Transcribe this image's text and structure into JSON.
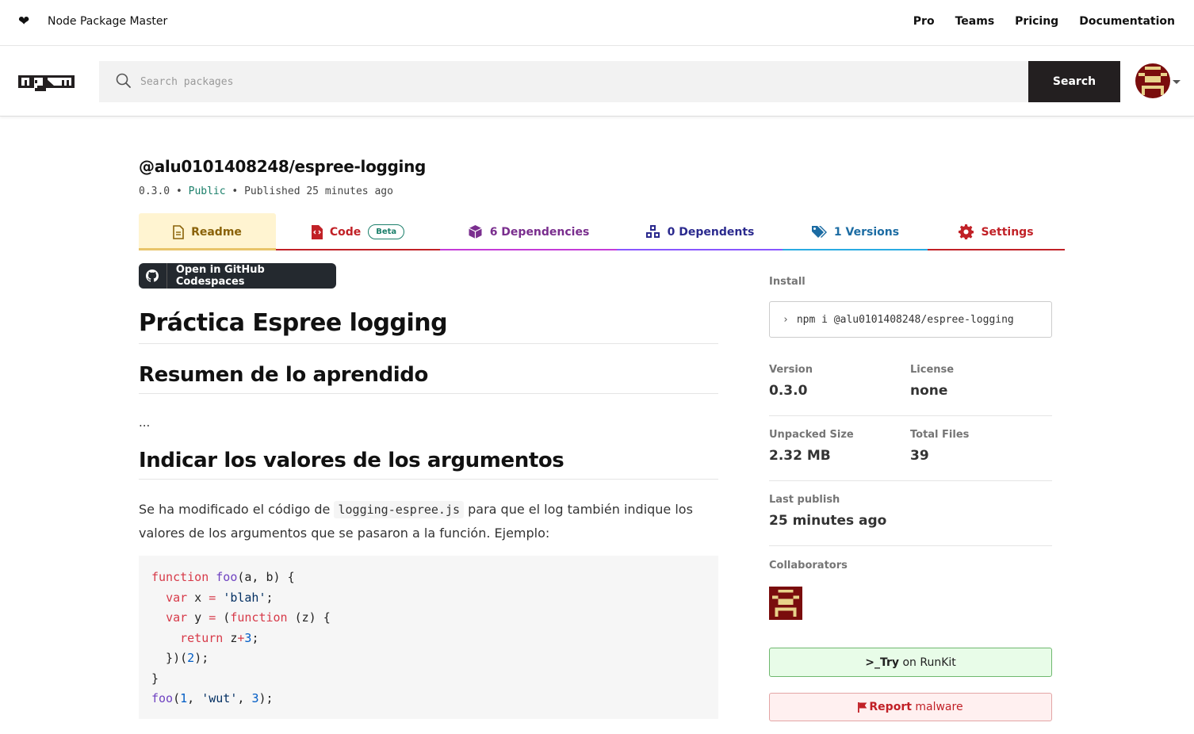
{
  "topbar": {
    "brand": "Node Package Master",
    "nav": [
      "Pro",
      "Teams",
      "Pricing",
      "Documentation"
    ]
  },
  "search": {
    "placeholder": "Search packages",
    "value": "",
    "button_label": "Search"
  },
  "package": {
    "name": "@alu0101408248/espree-logging",
    "version": "0.3.0",
    "visibility": "Public",
    "published": "Published 25 minutes ago",
    "separator": "•"
  },
  "tabs": {
    "readme": "Readme",
    "code": "Code",
    "code_badge": "Beta",
    "dependencies": "6 Dependencies",
    "dependents": "0 Dependents",
    "versions": "1 Versions",
    "settings": "Settings"
  },
  "codespaces_label": "Open in GitHub Codespaces",
  "readme": {
    "h1": "Práctica Espree logging",
    "h2_summary": "Resumen de lo aprendido",
    "ellipsis": "...",
    "h2_args": "Indicar los valores de los argumentos",
    "para_before": "Se ha modificado el código de ",
    "para_code": "logging-espree.js",
    "para_after": " para que el log también indique los valores de los argumentos que se pasaron a la función. Ejemplo:"
  },
  "sidebar": {
    "install_label": "Install",
    "install_prompt": "›",
    "install_command": "npm i @alu0101408248/espree-logging",
    "version_label": "Version",
    "version_value": "0.3.0",
    "license_label": "License",
    "license_value": "none",
    "unpacked_label": "Unpacked Size",
    "unpacked_value": "2.32 MB",
    "files_label": "Total Files",
    "files_value": "39",
    "last_publish_label": "Last publish",
    "last_publish_value": "25 minutes ago",
    "collaborators_label": "Collaborators",
    "runkit_prefix": ">_",
    "runkit_bold": "Try",
    "runkit_rest": " on RunKit",
    "report_bold": "Report",
    "report_rest": " malware"
  },
  "colors": {
    "accent_red": "#c12127",
    "public_green": "#1b7f6a",
    "avatar_red": "#7a0d0d",
    "avatar_yellow": "#e8d28a"
  },
  "icons": [
    "heart-icon",
    "npm-logo",
    "search-icon",
    "readme-icon",
    "code-icon",
    "dependencies-icon",
    "dependents-icon",
    "versions-icon",
    "settings-icon",
    "github-icon",
    "flag-icon"
  ]
}
